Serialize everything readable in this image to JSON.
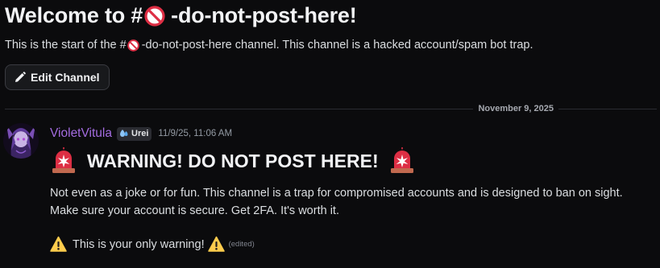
{
  "welcome": {
    "title_prefix": "Welcome to #",
    "channel_name": "-do-not-post-here!",
    "subtitle_prefix": "This is the start of the #",
    "subtitle_suffix": "-do-not-post-here channel. This channel is a hacked account/spam bot trap.",
    "edit_button_label": "Edit Channel",
    "channel_emoji": "no-entry-sign-icon"
  },
  "divider": {
    "date": "November 9, 2025"
  },
  "message": {
    "author": "VioletVitula",
    "author_color": "#a46ce0",
    "tag": "Urei",
    "timestamp": "11/9/25, 11:06 AM",
    "heading": "WARNING! DO NOT POST HERE!",
    "heading_icons": "siren-light-icon",
    "body_line1": "Not even as a joke or for fun. This channel is a trap for compromised accounts and is designed to ban on sight.",
    "body_line2": "Make sure your account is secure. Get 2FA. It's worth it.",
    "final_line": "This is your only warning!",
    "final_icons": "warning-icon",
    "edited_label": "(edited)"
  },
  "colors": {
    "background": "#0b0b0d",
    "text": "#dbdee1",
    "title": "#f2f3f5",
    "muted": "#949ba4"
  }
}
